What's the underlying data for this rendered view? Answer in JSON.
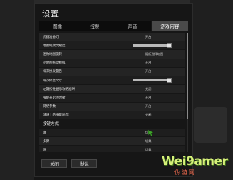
{
  "title": "设置",
  "tabs": [
    {
      "label": "图像",
      "active": false
    },
    {
      "label": "控制",
      "active": false
    },
    {
      "label": "声音",
      "active": false
    },
    {
      "label": "游戏内容",
      "active": true
    }
  ],
  "rows": [
    {
      "label": "武器准备灯",
      "value": "开启"
    },
    {
      "label": "地图缩放灵敏度",
      "slider_level": 0.9
    },
    {
      "label": "迷你地图旋转",
      "value": "随所选择地图"
    },
    {
      "label": "小地图拖动模拟",
      "value": "开启"
    },
    {
      "label": "每次换发警告",
      "value": "开启"
    },
    {
      "label": "每次修复尺寸",
      "slider_level": 0.9
    },
    {
      "label": "左键按住显示攻略准时",
      "value": "关闭"
    },
    {
      "label": "强制开启连时射",
      "value": "开启"
    },
    {
      "label": "网络参数",
      "value": "开启"
    },
    {
      "label": "减速上的按键响音",
      "value": "关闭"
    },
    {
      "label": "按键方式",
      "header": true
    },
    {
      "label": "蹲",
      "value": "切换"
    },
    {
      "label": "多倒",
      "value": "切换"
    },
    {
      "label": "跳",
      "value": "切换"
    }
  ],
  "scrollbar": {
    "position": 0.0,
    "visible_fraction": 0.72
  },
  "buttons": {
    "close": "关闭",
    "default": "默认"
  },
  "watermark": {
    "text": "Wei9amer",
    "sub": "伪游网"
  },
  "colors": {
    "active_tab": "#4a4a4a",
    "watermark": "#d7f07a",
    "watermark_sub": "#f06b4f"
  }
}
